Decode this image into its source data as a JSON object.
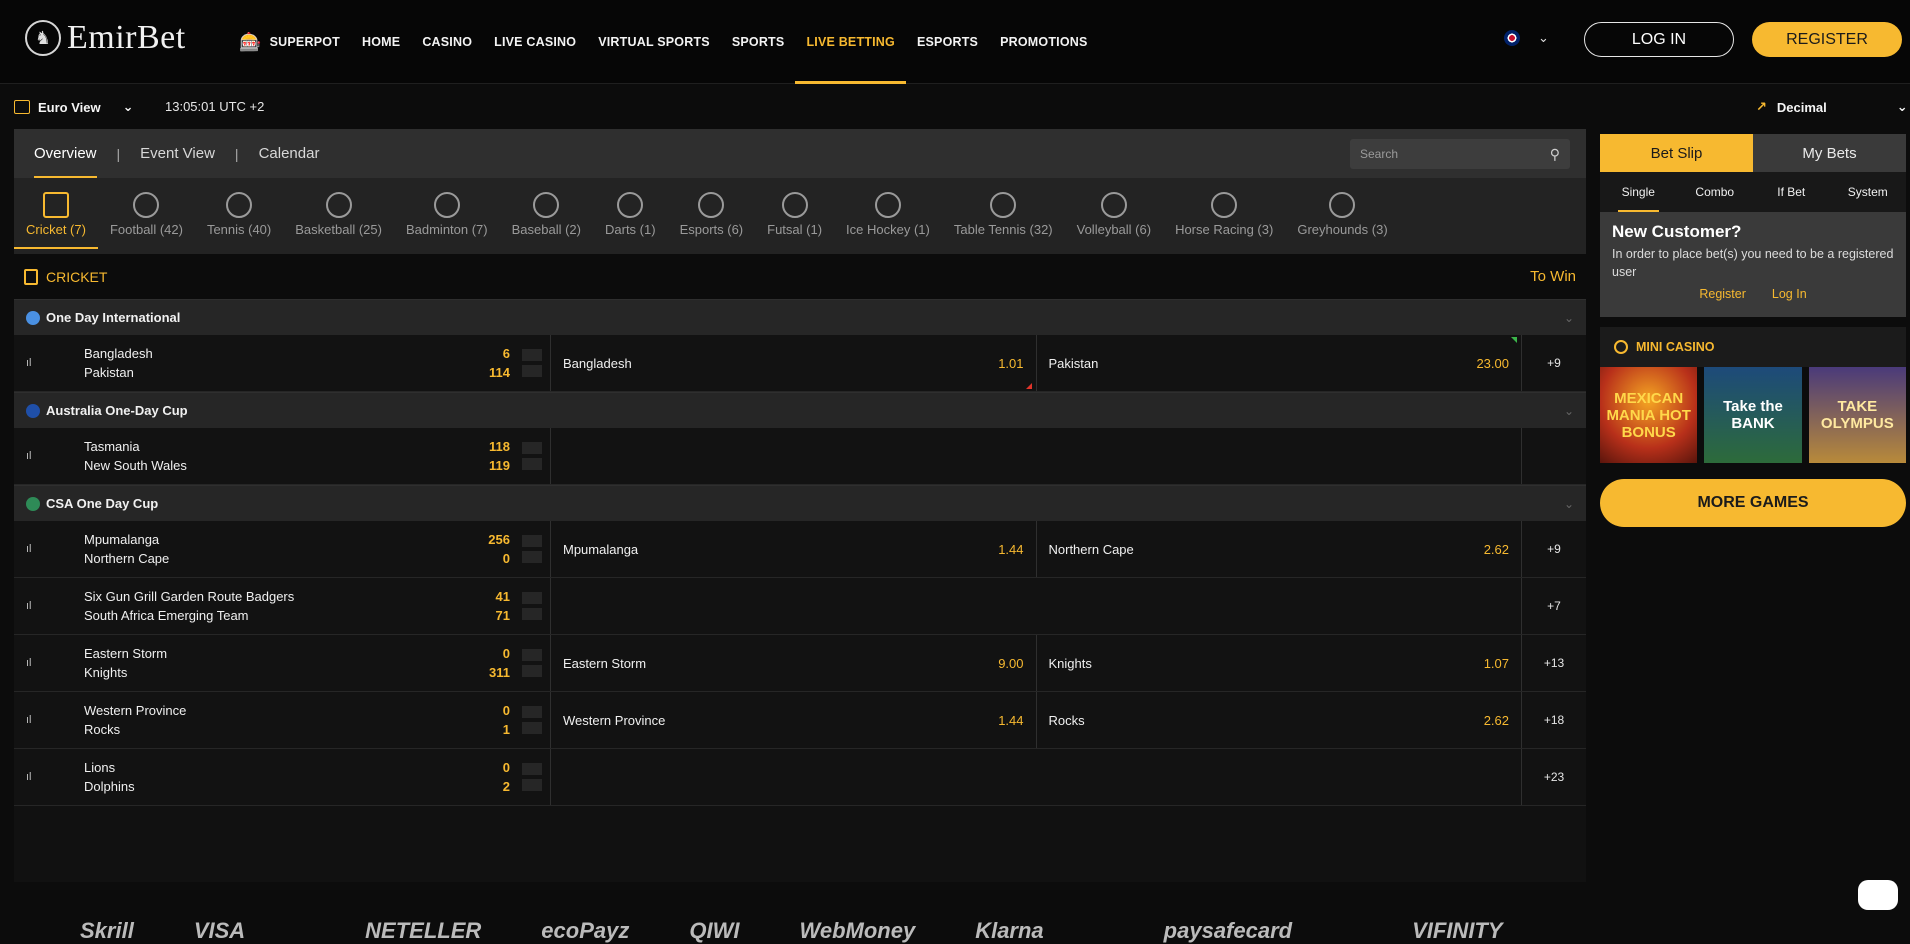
{
  "brand": {
    "name": "EmirBet"
  },
  "nav": [
    {
      "label": "SUPERPOT",
      "icon": "superpot-icon"
    },
    {
      "label": "HOME"
    },
    {
      "label": "CASINO"
    },
    {
      "label": "LIVE CASINO"
    },
    {
      "label": "VIRTUAL SPORTS"
    },
    {
      "label": "SPORTS"
    },
    {
      "label": "LIVE BETTING",
      "active": true
    },
    {
      "label": "ESPORTS"
    },
    {
      "label": "PROMOTIONS"
    }
  ],
  "auth": {
    "login": "LOG IN",
    "register": "REGISTER"
  },
  "subbar": {
    "view": "Euro View",
    "time": "13:05:01 UTC +2",
    "odds_format": "Decimal"
  },
  "tabs": [
    "Overview",
    "Event View",
    "Calendar"
  ],
  "search": {
    "placeholder": "Search"
  },
  "sports": [
    {
      "label": "Cricket (7)",
      "active": true
    },
    {
      "label": "Football (42)"
    },
    {
      "label": "Tennis (40)"
    },
    {
      "label": "Basketball (25)"
    },
    {
      "label": "Badminton (7)"
    },
    {
      "label": "Baseball (2)"
    },
    {
      "label": "Darts (1)"
    },
    {
      "label": "Esports (6)"
    },
    {
      "label": "Futsal (1)"
    },
    {
      "label": "Ice Hockey (1)"
    },
    {
      "label": "Table Tennis (32)"
    },
    {
      "label": "Volleyball (6)"
    },
    {
      "label": "Horse Racing (3)"
    },
    {
      "label": "Greyhounds (3)"
    }
  ],
  "section": {
    "title": "CRICKET",
    "market": "To Win"
  },
  "leagues": [
    {
      "name": "One Day International",
      "flag_color": "#4a90e2",
      "matches": [
        {
          "team1": "Bangladesh",
          "team2": "Pakistan",
          "score1": "6",
          "score2": "114",
          "odd1_name": "Bangladesh",
          "odd1": "1.01",
          "odd2_name": "Pakistan",
          "odd2": "23.00",
          "more": "+9"
        }
      ]
    },
    {
      "name": "Australia One-Day Cup",
      "flag_color": "#1f4fa8",
      "matches": [
        {
          "team1": "Tasmania",
          "team2": "New South Wales",
          "score1": "118",
          "score2": "119",
          "odd1_name": "",
          "odd1": "",
          "odd2_name": "",
          "odd2": "",
          "more": ""
        }
      ]
    },
    {
      "name": "CSA One Day Cup",
      "flag_color": "#2e8b57",
      "matches": [
        {
          "team1": "Mpumalanga",
          "team2": "Northern Cape",
          "score1": "256",
          "score2": "0",
          "odd1_name": "Mpumalanga",
          "odd1": "1.44",
          "odd2_name": "Northern Cape",
          "odd2": "2.62",
          "more": "+9"
        },
        {
          "team1": "Six Gun Grill Garden Route Badgers",
          "team2": "South Africa Emerging Team",
          "score1": "41",
          "score2": "71",
          "odd1_name": "",
          "odd1": "",
          "odd2_name": "",
          "odd2": "",
          "more": "+7"
        },
        {
          "team1": "Eastern Storm",
          "team2": "Knights",
          "score1": "0",
          "score2": "311",
          "odd1_name": "Eastern Storm",
          "odd1": "9.00",
          "odd2_name": "Knights",
          "odd2": "1.07",
          "more": "+13"
        },
        {
          "team1": "Western Province",
          "team2": "Rocks",
          "score1": "0",
          "score2": "1",
          "odd1_name": "Western Province",
          "odd1": "1.44",
          "odd2_name": "Rocks",
          "odd2": "2.62",
          "more": "+18"
        },
        {
          "team1": "Lions",
          "team2": "Dolphins",
          "score1": "0",
          "score2": "2",
          "odd1_name": "",
          "odd1": "",
          "odd2_name": "",
          "odd2": "",
          "more": "+23"
        }
      ]
    }
  ],
  "betslip": {
    "tabs": [
      "Bet Slip",
      "My Bets"
    ],
    "types": [
      "Single",
      "Combo",
      "If Bet",
      "System"
    ],
    "new_customer_title": "New Customer?",
    "new_customer_text": "In order to place bet(s) you need to be a registered user",
    "register_link": "Register",
    "login_link": "Log In"
  },
  "mini_casino": {
    "title": "MINI CASINO",
    "games": [
      "MEXICAN MANIA HOT BONUS",
      "Take the BANK",
      "TAKE OLYMPUS"
    ],
    "more_button": "MORE GAMES"
  },
  "payments": [
    "Skrill",
    "VISA",
    "",
    "NETELLER",
    "ecoPayz",
    "QIWI",
    "WebMoney",
    "Klarna",
    "",
    "paysafecard",
    "",
    "VIFINITY"
  ],
  "colors": {
    "accent": "#f7b930",
    "background": "#0c0c0c",
    "panel": "#2f2f2f"
  }
}
